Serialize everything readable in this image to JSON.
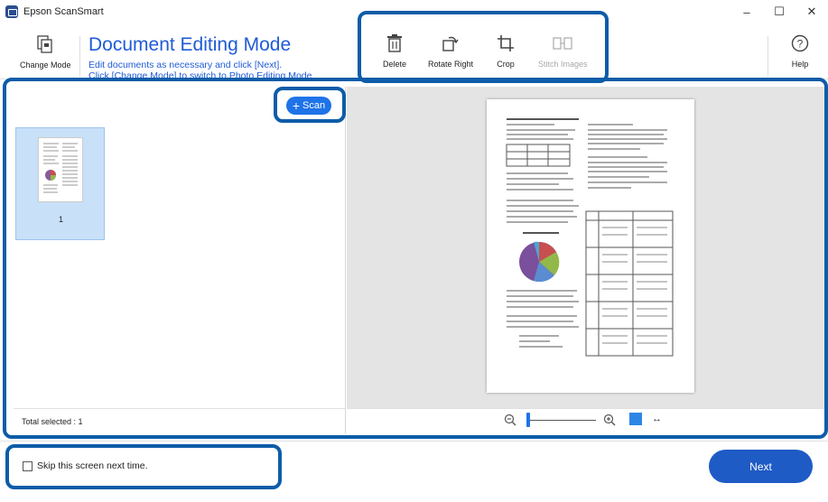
{
  "app": {
    "title": "Epson ScanSmart"
  },
  "window_controls": {
    "minimize": "–",
    "maximize": "☐",
    "close": "✕"
  },
  "toolbar": {
    "change_mode": "Change Mode",
    "mode_title": "Document Editing Mode",
    "mode_subtitle_line1": "Edit documents as necessary and click [Next].",
    "mode_subtitle_line2": "Click [Change Mode] to switch to Photo Editing Mode.",
    "delete": "Delete",
    "rotate_right": "Rotate Right",
    "crop": "Crop",
    "stitch_images": "Stitch Images",
    "help": "Help"
  },
  "scan_button": {
    "label": "Scan"
  },
  "thumbnails": [
    {
      "number": "1",
      "selected": true
    }
  ],
  "status": {
    "total_selected": "Total selected : 1"
  },
  "zoom": {
    "expand_label": "↔"
  },
  "footer": {
    "skip_label": "Skip this screen next time.",
    "skip_checked": false,
    "next_label": "Next"
  },
  "colors": {
    "accent": "#1f5bd6",
    "highlight_border": "#0d5ca8",
    "button_blue": "#1f5bc5",
    "selection_bg": "#c8e0f8"
  }
}
